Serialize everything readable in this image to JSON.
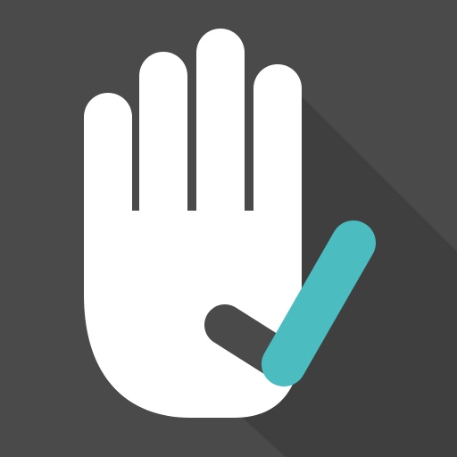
{
  "icon": {
    "name": "raised-hand-check-icon",
    "colors": {
      "background": "#4a4a4a",
      "shadow": "#3f3f3f",
      "hand": "#ffffff",
      "check_short": "#4a4a4a",
      "check_long": "#4bbdc0"
    }
  }
}
